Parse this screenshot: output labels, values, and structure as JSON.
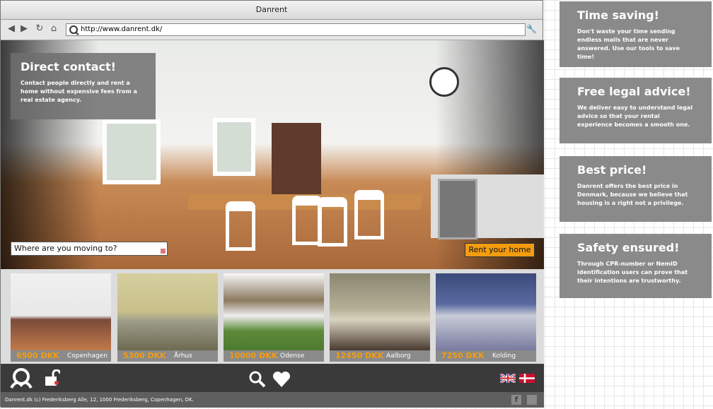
{
  "window": {
    "title": "Danrent"
  },
  "toolbar": {
    "back_icon": "arrow-left-icon",
    "forward_icon": "arrow-right-icon",
    "reload_icon": "reload-icon",
    "home_icon": "home-icon",
    "url": "http://www.danrent.dk/",
    "settings_icon": "wrench-icon"
  },
  "hero": {
    "title": "Direct contact!",
    "text": "Contact people directly and rent a home without expensive fees from a real estate agency.",
    "search_placeholder": "Where are you moving to?",
    "rent_button": "Rent your home"
  },
  "listings": [
    {
      "price": "6500 DKK",
      "city": "Copenhagen"
    },
    {
      "price": "5300 DKK",
      "city": "Århus"
    },
    {
      "price": "10000 DKK",
      "city": "Odense"
    },
    {
      "price": "12450 DKK",
      "city": "Aalborg"
    },
    {
      "price": "7250 DKK",
      "city": "Kolding"
    }
  ],
  "footer": {
    "text": "Danrent.dk (c) Frederiksberg Alle, 12, 1000 Frederiksberg, Copenhagen, DK."
  },
  "features": [
    {
      "title": "Time saving!",
      "text": "Don't waste your time sending endless mails that are never answered. Use our tools to save time!"
    },
    {
      "title": "Free legal advice!",
      "text": "We deliver easy to understand legal advice so that your rental experience becomes a smooth one."
    },
    {
      "title": "Best price!",
      "text": "Danrent offers the best price in Denmark, because we believe that housing is a right not a privilege."
    },
    {
      "title": "Safety ensured!",
      "text": "Through CPR-number or NemID identification users can prove that their intentions are trustworthy."
    }
  ],
  "colors": {
    "accent": "#f39c10",
    "panel": "#8a8a8a",
    "bar": "#3a3a3a"
  }
}
